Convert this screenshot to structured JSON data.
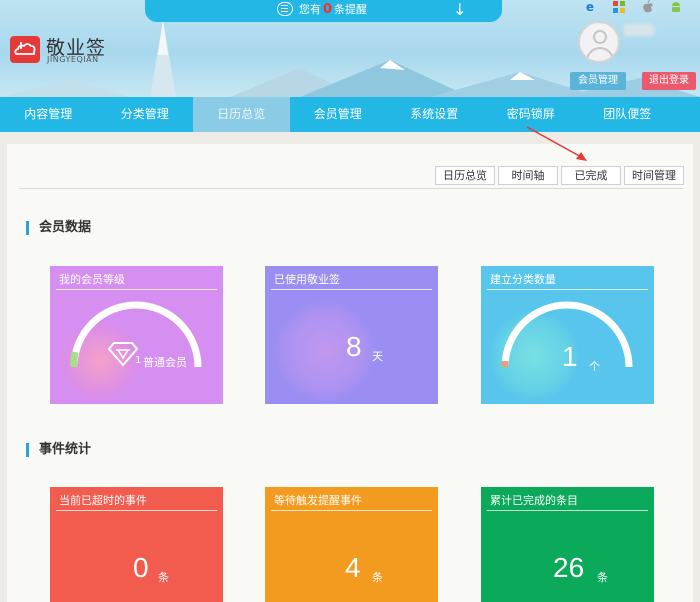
{
  "notice": {
    "prefix": "您有",
    "count": "0",
    "suffix": "条提醒"
  },
  "logo": {
    "name": "敬业签",
    "sub": "JINGYEQIAN"
  },
  "user": {
    "member_button": "会员管理",
    "logout_button": "退出登录"
  },
  "nav": {
    "items": [
      "内容管理",
      "分类管理",
      "日历总览",
      "会员管理",
      "系统设置",
      "密码锁屏",
      "团队便签"
    ],
    "active_index": 2
  },
  "tabs": [
    "日历总览",
    "时间轴",
    "已完成",
    "时间管理"
  ],
  "sections": {
    "member": "会员数据",
    "events": "事件统计"
  },
  "member_cards": [
    {
      "title": "我的会员等级",
      "level": "1",
      "level_label": "普通会员",
      "color": "#d48ff0"
    },
    {
      "title": "已使用敬业签",
      "value": "8",
      "unit": "天",
      "color": "#9b8ef3"
    },
    {
      "title": "建立分类数量",
      "value": "1",
      "unit": "个",
      "color": "#58c5ec"
    }
  ],
  "event_cards": [
    {
      "title": "当前已超时的事件",
      "value": "0",
      "unit": "条",
      "color": "#f25c4f"
    },
    {
      "title": "等待触发提醒事件",
      "value": "4",
      "unit": "条",
      "color": "#f39b1e"
    },
    {
      "title": "累计已完成的条目",
      "value": "26",
      "unit": "条",
      "color": "#0aaa5a"
    }
  ]
}
